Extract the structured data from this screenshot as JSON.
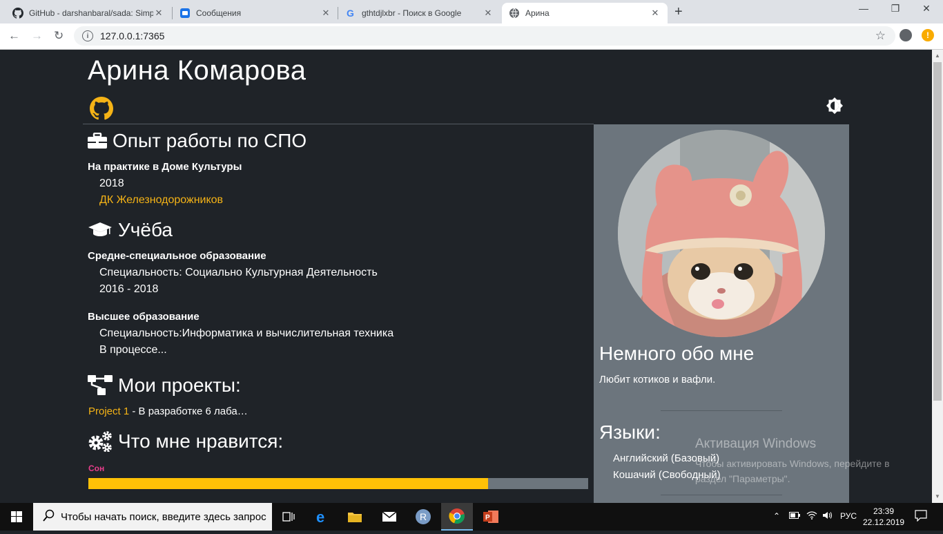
{
  "browser": {
    "tabs": [
      {
        "title": "GitHub - darshanbaral/sada: Simple",
        "icon": "github-icon"
      },
      {
        "title": "Сообщения",
        "icon": "messages-icon"
      },
      {
        "title": "gthtdjlxbr - Поиск в Google",
        "icon": "google-icon"
      },
      {
        "title": "Арина",
        "icon": "globe-icon"
      }
    ],
    "url": "127.0.0.1:7365"
  },
  "page": {
    "name": "Арина Комарова",
    "experience": {
      "title": "Опыт работы по СПО",
      "items": [
        {
          "heading": "На практике в Доме Культуры",
          "year": "2018",
          "place": "ДК Железнодорожников"
        }
      ]
    },
    "education": {
      "title": "Учёба",
      "items": [
        {
          "heading": "Средне-специальное образование",
          "specialty": "Специальность: Социально Культурная Деятельность",
          "period": "2016 - 2018"
        },
        {
          "heading": "Высшее образование",
          "specialty": "Специальность:Информатика и вычислительная техника",
          "period": "В процессе..."
        }
      ]
    },
    "projects": {
      "title": "Мои проекты:",
      "items": [
        {
          "name": "Project 1",
          "description": " - В разработке 6 лаба…"
        }
      ]
    },
    "likes": {
      "title": "Что мне нравится:",
      "items": [
        {
          "label": "Сон",
          "level": 0.8
        }
      ]
    },
    "sidebar": {
      "about_title": "Немного обо мне",
      "about_text": "Любит котиков и вафли.",
      "languages_title": "Языки:",
      "languages": [
        "Английский (Базовый)",
        "Кошачий (Свободный)"
      ]
    }
  },
  "watermark": {
    "title": "Активация Windows",
    "line1": "Чтобы активировать Windows, перейдите в",
    "line2": "раздел \"Параметры\"."
  },
  "taskbar": {
    "search_placeholder": "Чтобы начать поиск, введите здесь запрос",
    "language": "РУС",
    "time": "23:39",
    "date": "22.12.2019"
  },
  "colors": {
    "accent": "#f5b316",
    "background": "#1f2328",
    "sidebar": "#6c757d",
    "skill_label": "#e83e8c",
    "bar_fill": "#ffc107"
  }
}
